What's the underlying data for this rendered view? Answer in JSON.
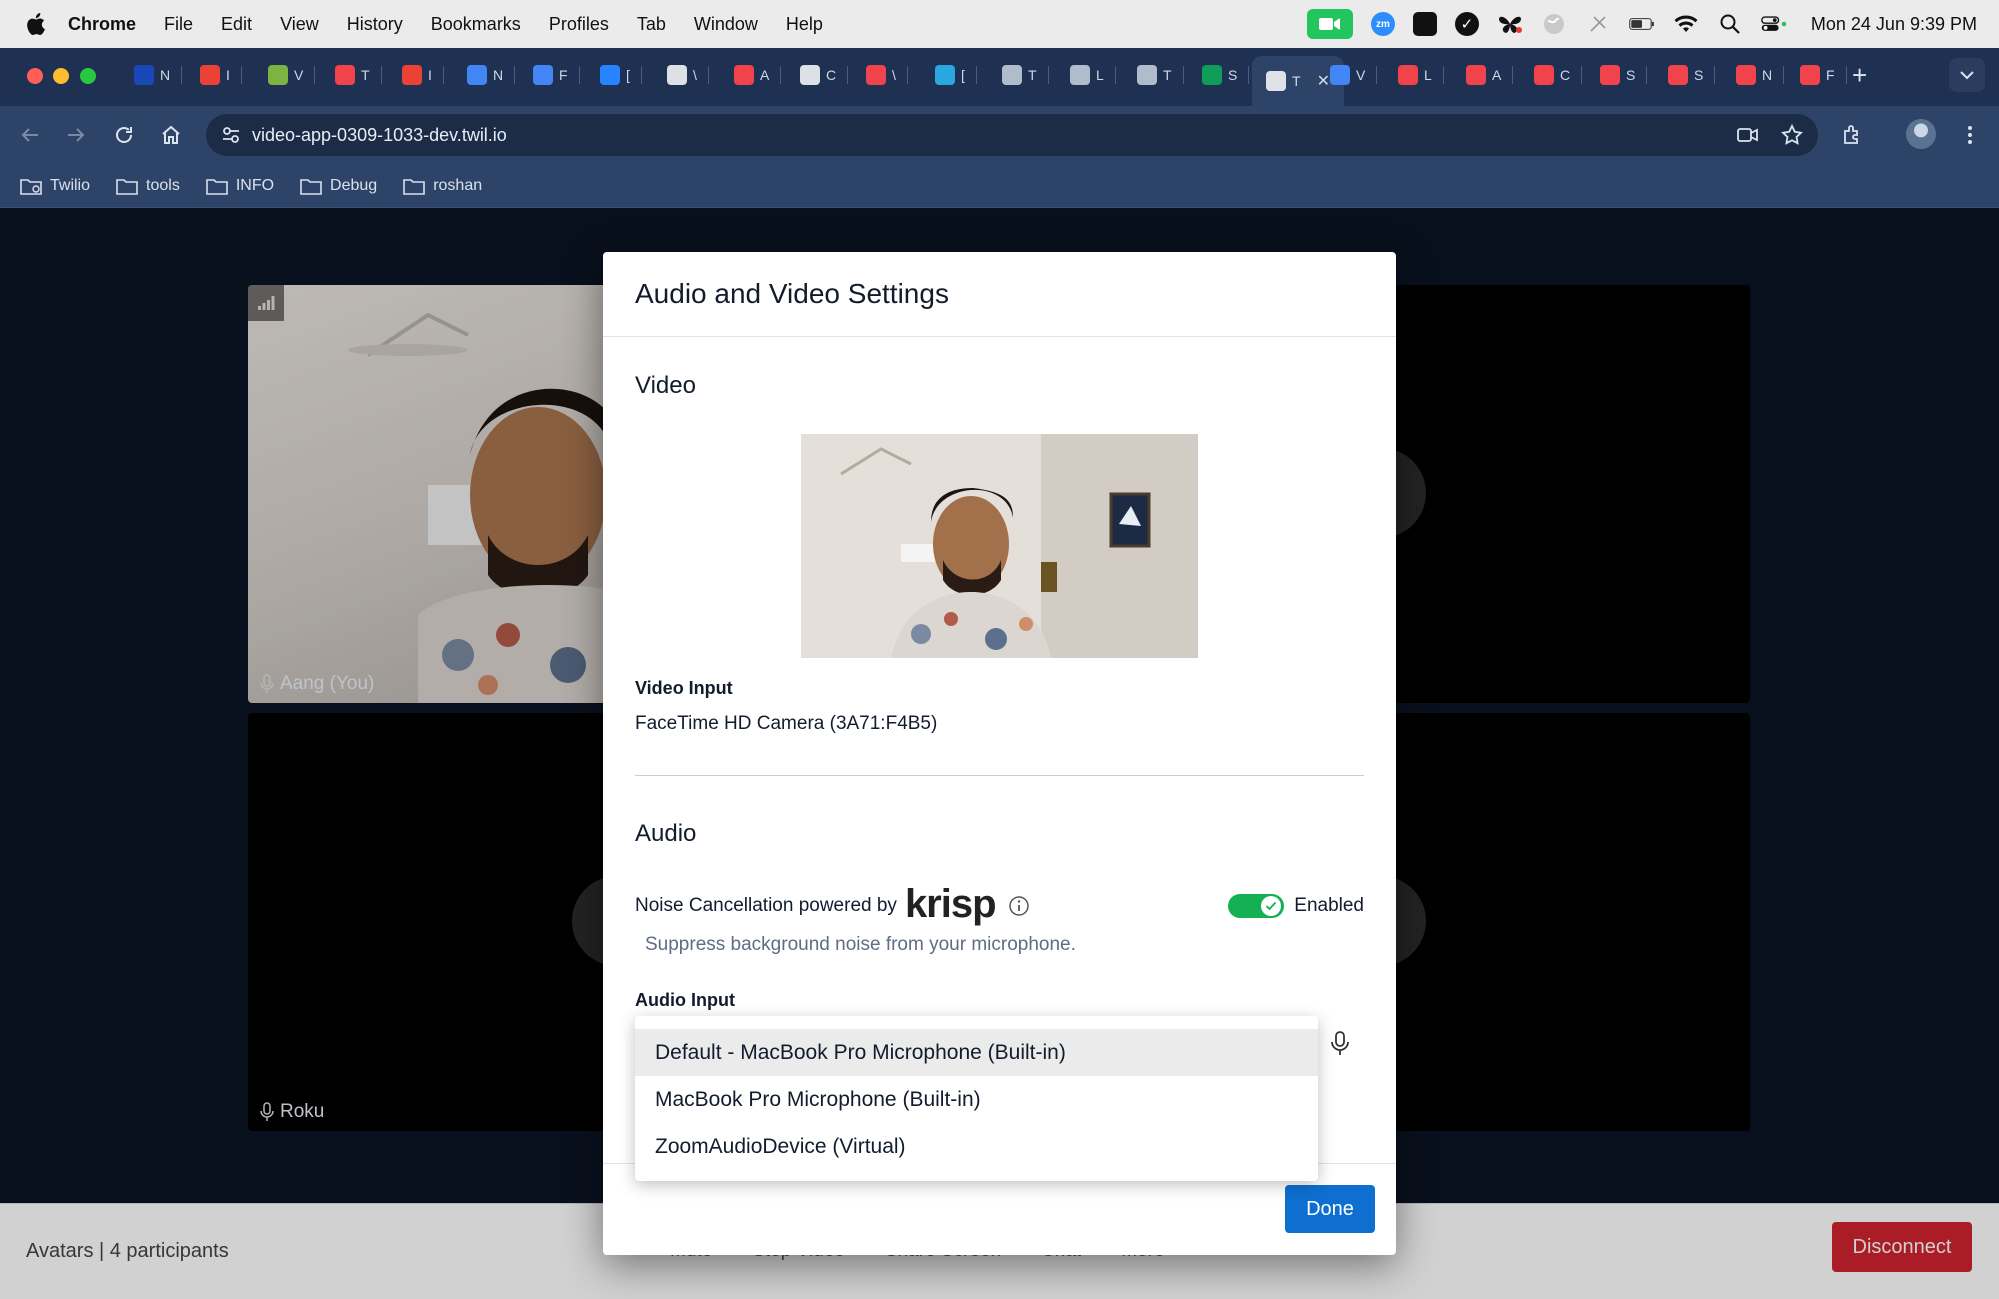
{
  "menubar": {
    "app": "Chrome",
    "items": [
      "File",
      "Edit",
      "View",
      "History",
      "Bookmarks",
      "Profiles",
      "Tab",
      "Window",
      "Help"
    ],
    "clock": "Mon 24 Jun  9:39 PM",
    "zoom_label": "zm"
  },
  "tabs": [
    {
      "label": "N",
      "color": "#1a47b8"
    },
    {
      "label": "I",
      "color": "#ea4335"
    },
    {
      "label": "V",
      "color": "#7cb342"
    },
    {
      "label": "T",
      "color": "#f0434b"
    },
    {
      "label": "I",
      "color": "#ea4335"
    },
    {
      "label": "N",
      "color": "#4285f4"
    },
    {
      "label": "F",
      "color": "#4285f4"
    },
    {
      "label": "[",
      "color": "#2684ff"
    },
    {
      "label": "\\",
      "color": "#ffffff"
    },
    {
      "label": "A",
      "color": "#f0434b"
    },
    {
      "label": "C",
      "color": "#ffffff"
    },
    {
      "label": "\\",
      "color": "#f0434b"
    },
    {
      "label": "[",
      "color": "#29a8e0"
    },
    {
      "label": "T",
      "color": "#b0bccb"
    },
    {
      "label": "L",
      "color": "#b0bccb"
    },
    {
      "label": "T",
      "color": "#b0bccb"
    },
    {
      "label": "S",
      "color": "#0f9d58"
    },
    {
      "label": "T",
      "color": "#ffffff"
    },
    {
      "label": "V",
      "color": "#4285f4"
    },
    {
      "label": "L",
      "color": "#f0434b"
    },
    {
      "label": "A",
      "color": "#f0434b"
    },
    {
      "label": "C",
      "color": "#f0434b"
    },
    {
      "label": "S",
      "color": "#f0434b"
    },
    {
      "label": "S",
      "color": "#f0434b"
    },
    {
      "label": "N",
      "color": "#f0434b"
    },
    {
      "label": "F",
      "color": "#f0434b"
    }
  ],
  "toolbar": {
    "url": "video-app-0309-1033-dev.twil.io"
  },
  "bookmarks": [
    "Twilio",
    "tools",
    "INFO",
    "Debug",
    "roshan"
  ],
  "participants": {
    "you": "Aang (You)",
    "other": "Roku"
  },
  "bottombar": {
    "room": "Avatars | 4 participants",
    "controls": [
      "Mute",
      "Stop Video",
      "Share Screen",
      "Chat",
      "More"
    ],
    "disconnect": "Disconnect"
  },
  "modal": {
    "title": "Audio and Video Settings",
    "video_section": "Video",
    "video_input_label": "Video Input",
    "video_input_value": "FaceTime HD Camera (3A71:F4B5)",
    "audio_section": "Audio",
    "nc_label": "Noise Cancellation powered by",
    "krisp_logo": "krisp",
    "nc_status": "Enabled",
    "nc_help": "Suppress background noise from your microphone.",
    "audio_input_label": "Audio Input",
    "done": "Done"
  },
  "audio_input_options": [
    "Default - MacBook Pro Microphone (Built-in)",
    "MacBook Pro Microphone (Built-in)",
    "ZoomAudioDevice (Virtual)"
  ],
  "audio_input_selected": "Default - MacBook Pro Microphone (Built-in)",
  "colors": {
    "toggle_on": "#14b053",
    "done_button": "#0e6fd1",
    "disconnect_button": "#d1242f",
    "tab_strip": "#1f3152"
  }
}
